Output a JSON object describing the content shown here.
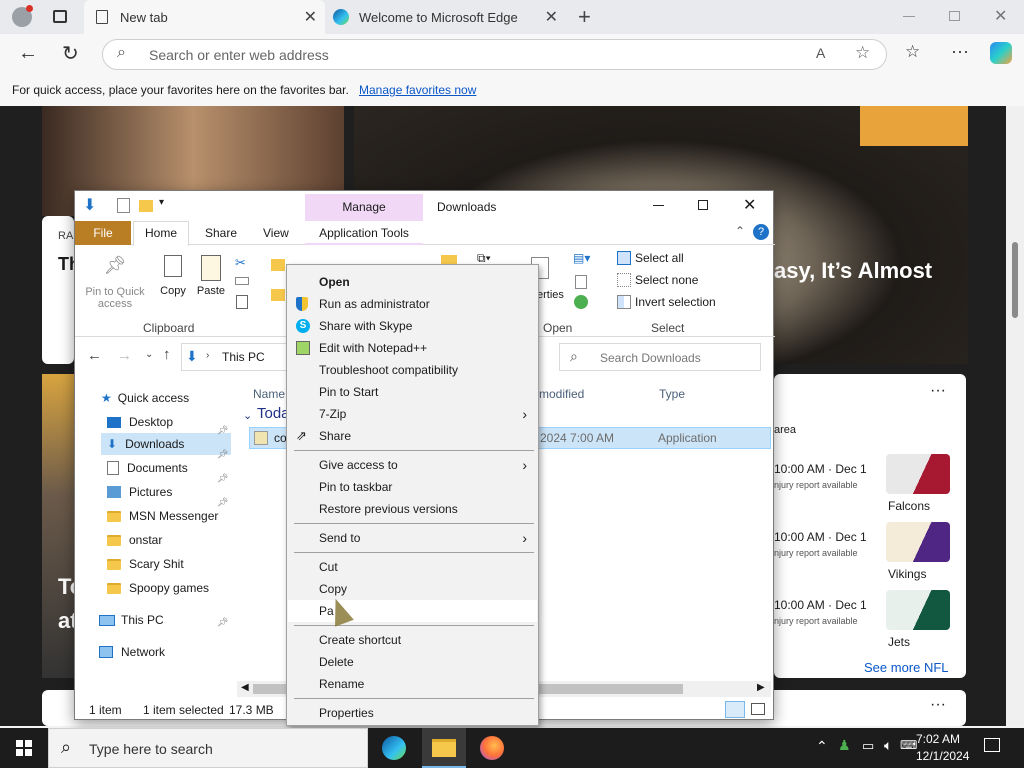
{
  "browser": {
    "tabs": [
      {
        "title": "New tab"
      },
      {
        "title": "Welcome to Microsoft Edge"
      }
    ],
    "address_placeholder": "Search or enter web address",
    "favbar_text": "For quick access, place your favorites here on the favorites bar.",
    "favbar_link": "Manage favorites now"
  },
  "page": {
    "headline_fragment": "asy, It’s Almost",
    "left_fragment_1": "RA",
    "left_fragment_2": "Th",
    "left_fragment_3": "To",
    "left_fragment_4": "at",
    "nfl": {
      "area_label": "area",
      "games": [
        {
          "time": "10:00 AM · Dec 1",
          "note": "njury report available",
          "team": "Falcons",
          "color1": "#a71930",
          "color2": "#e8e8e8"
        },
        {
          "time": "10:00 AM · Dec 1",
          "note": "njury report available",
          "team": "Vikings",
          "color1": "#4f2683",
          "color2": "#ffc62f"
        },
        {
          "time": "10:00 AM · Dec 1",
          "note": "njury report available",
          "team": "Jets",
          "color1": "#125740",
          "color2": "#ffffff"
        }
      ],
      "see_more": "See more NFL"
    }
  },
  "explorer": {
    "title": "Downloads",
    "manage_tab": "Manage",
    "tabs": [
      "File",
      "Home",
      "Share",
      "View",
      "Application Tools"
    ],
    "clipboard": {
      "pin_label": "Pin to Quick access",
      "copy_label": "Copy",
      "paste_label": "Paste",
      "group": "Clipboard"
    },
    "open_group": "Open",
    "open_fragment": "erties",
    "select": {
      "select_all": "Select all",
      "select_none": "Select none",
      "invert": "Invert selection",
      "group": "Select"
    },
    "path": "This PC",
    "search_placeholder": "Search Downloads",
    "columns": {
      "name": "Name",
      "modified": "modified",
      "type": "Type"
    },
    "group_header": "Toda",
    "file": {
      "name_fragment": "co",
      "date": "2024 7:00 AM",
      "type": "Application"
    },
    "nav": [
      {
        "label": "Quick access",
        "pinned": false
      },
      {
        "label": "Desktop",
        "pinned": true
      },
      {
        "label": "Downloads",
        "pinned": true
      },
      {
        "label": "Documents",
        "pinned": true
      },
      {
        "label": "Pictures",
        "pinned": true
      },
      {
        "label": "MSN Messenger",
        "pinned": false
      },
      {
        "label": "onstar",
        "pinned": false
      },
      {
        "label": "Scary Shit",
        "pinned": false
      },
      {
        "label": "Spoopy games",
        "pinned": false
      },
      {
        "label": "This PC",
        "pinned": false
      },
      {
        "label": "Network",
        "pinned": false
      }
    ],
    "status": {
      "count": "1 item",
      "selected": "1 item selected",
      "size": "17.3 MB"
    }
  },
  "context_menu": {
    "items": [
      {
        "label": "Open",
        "bold": true
      },
      {
        "label": "Run as administrator"
      },
      {
        "label": "Share with Skype"
      },
      {
        "label": "Edit with Notepad++"
      },
      {
        "label": "Troubleshoot compatibility"
      },
      {
        "label": "Pin to Start"
      },
      {
        "label": "7-Zip",
        "submenu": true
      },
      {
        "label": "Share"
      },
      {
        "label": "Give access to",
        "submenu": true
      },
      {
        "label": "Pin to taskbar"
      },
      {
        "label": "Restore previous versions"
      },
      {
        "label": "Send to",
        "submenu": true
      },
      {
        "label": "Cut"
      },
      {
        "label": "Copy"
      },
      {
        "label": "Pa"
      },
      {
        "label": "Create shortcut"
      },
      {
        "label": "Delete"
      },
      {
        "label": "Rename"
      },
      {
        "label": "Properties"
      }
    ]
  },
  "taskbar": {
    "search_placeholder": "Type here to search",
    "time": "7:02 AM",
    "date": "12/1/2024"
  }
}
